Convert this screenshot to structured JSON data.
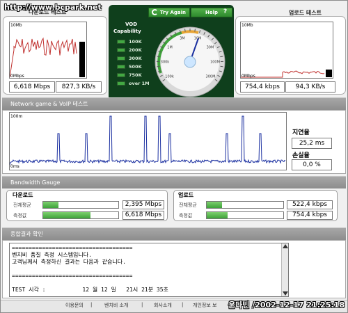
{
  "watermark": "http://www.bcpark.net",
  "download": {
    "title": "다운로드 테스트",
    "axis_top": "10Mb",
    "axis_bottom": "0Mbps",
    "mbps": "6,618 Mbps",
    "kbs": "827,3 KB/s"
  },
  "upload": {
    "title": "업로드 테스트",
    "axis_top": "10Mb",
    "axis_bottom": "0Mbps",
    "mbps": "754,4 kbps",
    "kbs": "94,3 KB/s"
  },
  "vod": {
    "title": "VOD",
    "subtitle": "Capability",
    "levels": [
      "100K",
      "200K",
      "300K",
      "500K",
      "750K",
      "over 1M"
    ]
  },
  "buttons": {
    "try_again": "Try Again",
    "help": "Help",
    "help_icon": "?"
  },
  "speedometer": {
    "ticks": [
      "100k",
      "300k",
      "1M",
      "3M",
      "10M",
      "30M",
      "100M",
      "300M"
    ],
    "needle_value": "1M"
  },
  "network": {
    "title": "Network game & VoIP 테스트",
    "axis_top": "100m",
    "axis_bottom": "0ms",
    "latency_label": "지연율",
    "latency_value": "25,2 ms",
    "loss_label": "손실율",
    "loss_value": "0,0 %"
  },
  "bandwidth": {
    "title": "Bandwidth Gauge",
    "download_label": "다운로드",
    "upload_label": "업로드",
    "avg_label": "전체평균",
    "measured_label": "측정값",
    "down_avg_value": "2,395 Mbps",
    "down_measured_value": "6,618 Mbps",
    "up_avg_value": "522,4 kbps",
    "up_measured_value": "754,4 kbps",
    "down_avg_fill": 0.2,
    "down_measured_fill": 0.63,
    "up_avg_fill": 0.2,
    "up_measured_fill": 0.27
  },
  "summary": {
    "title": "종합결과 확인",
    "lines": [
      "====================================",
      "벤치비 품질 측정 시스템입니다.",
      "고객님께서 측정하신 결과는 다음과 같습니다.",
      "",
      "====================================",
      "",
      "TEST 시각 :           12 월 12 일   21시 21분 35초"
    ]
  },
  "footer": {
    "links": [
      "이용문의",
      "벤치비 소개",
      "회사소개",
      "개인정보 보"
    ],
    "separator": "|",
    "stamp": "윤다빈 /2002-12-17 21:25:18"
  },
  "colors": {
    "graph_line": "#1a2fa0",
    "download_line": "#c0302e",
    "accent_green": "#3ea33a",
    "dark_green": "#0f3f1c"
  }
}
